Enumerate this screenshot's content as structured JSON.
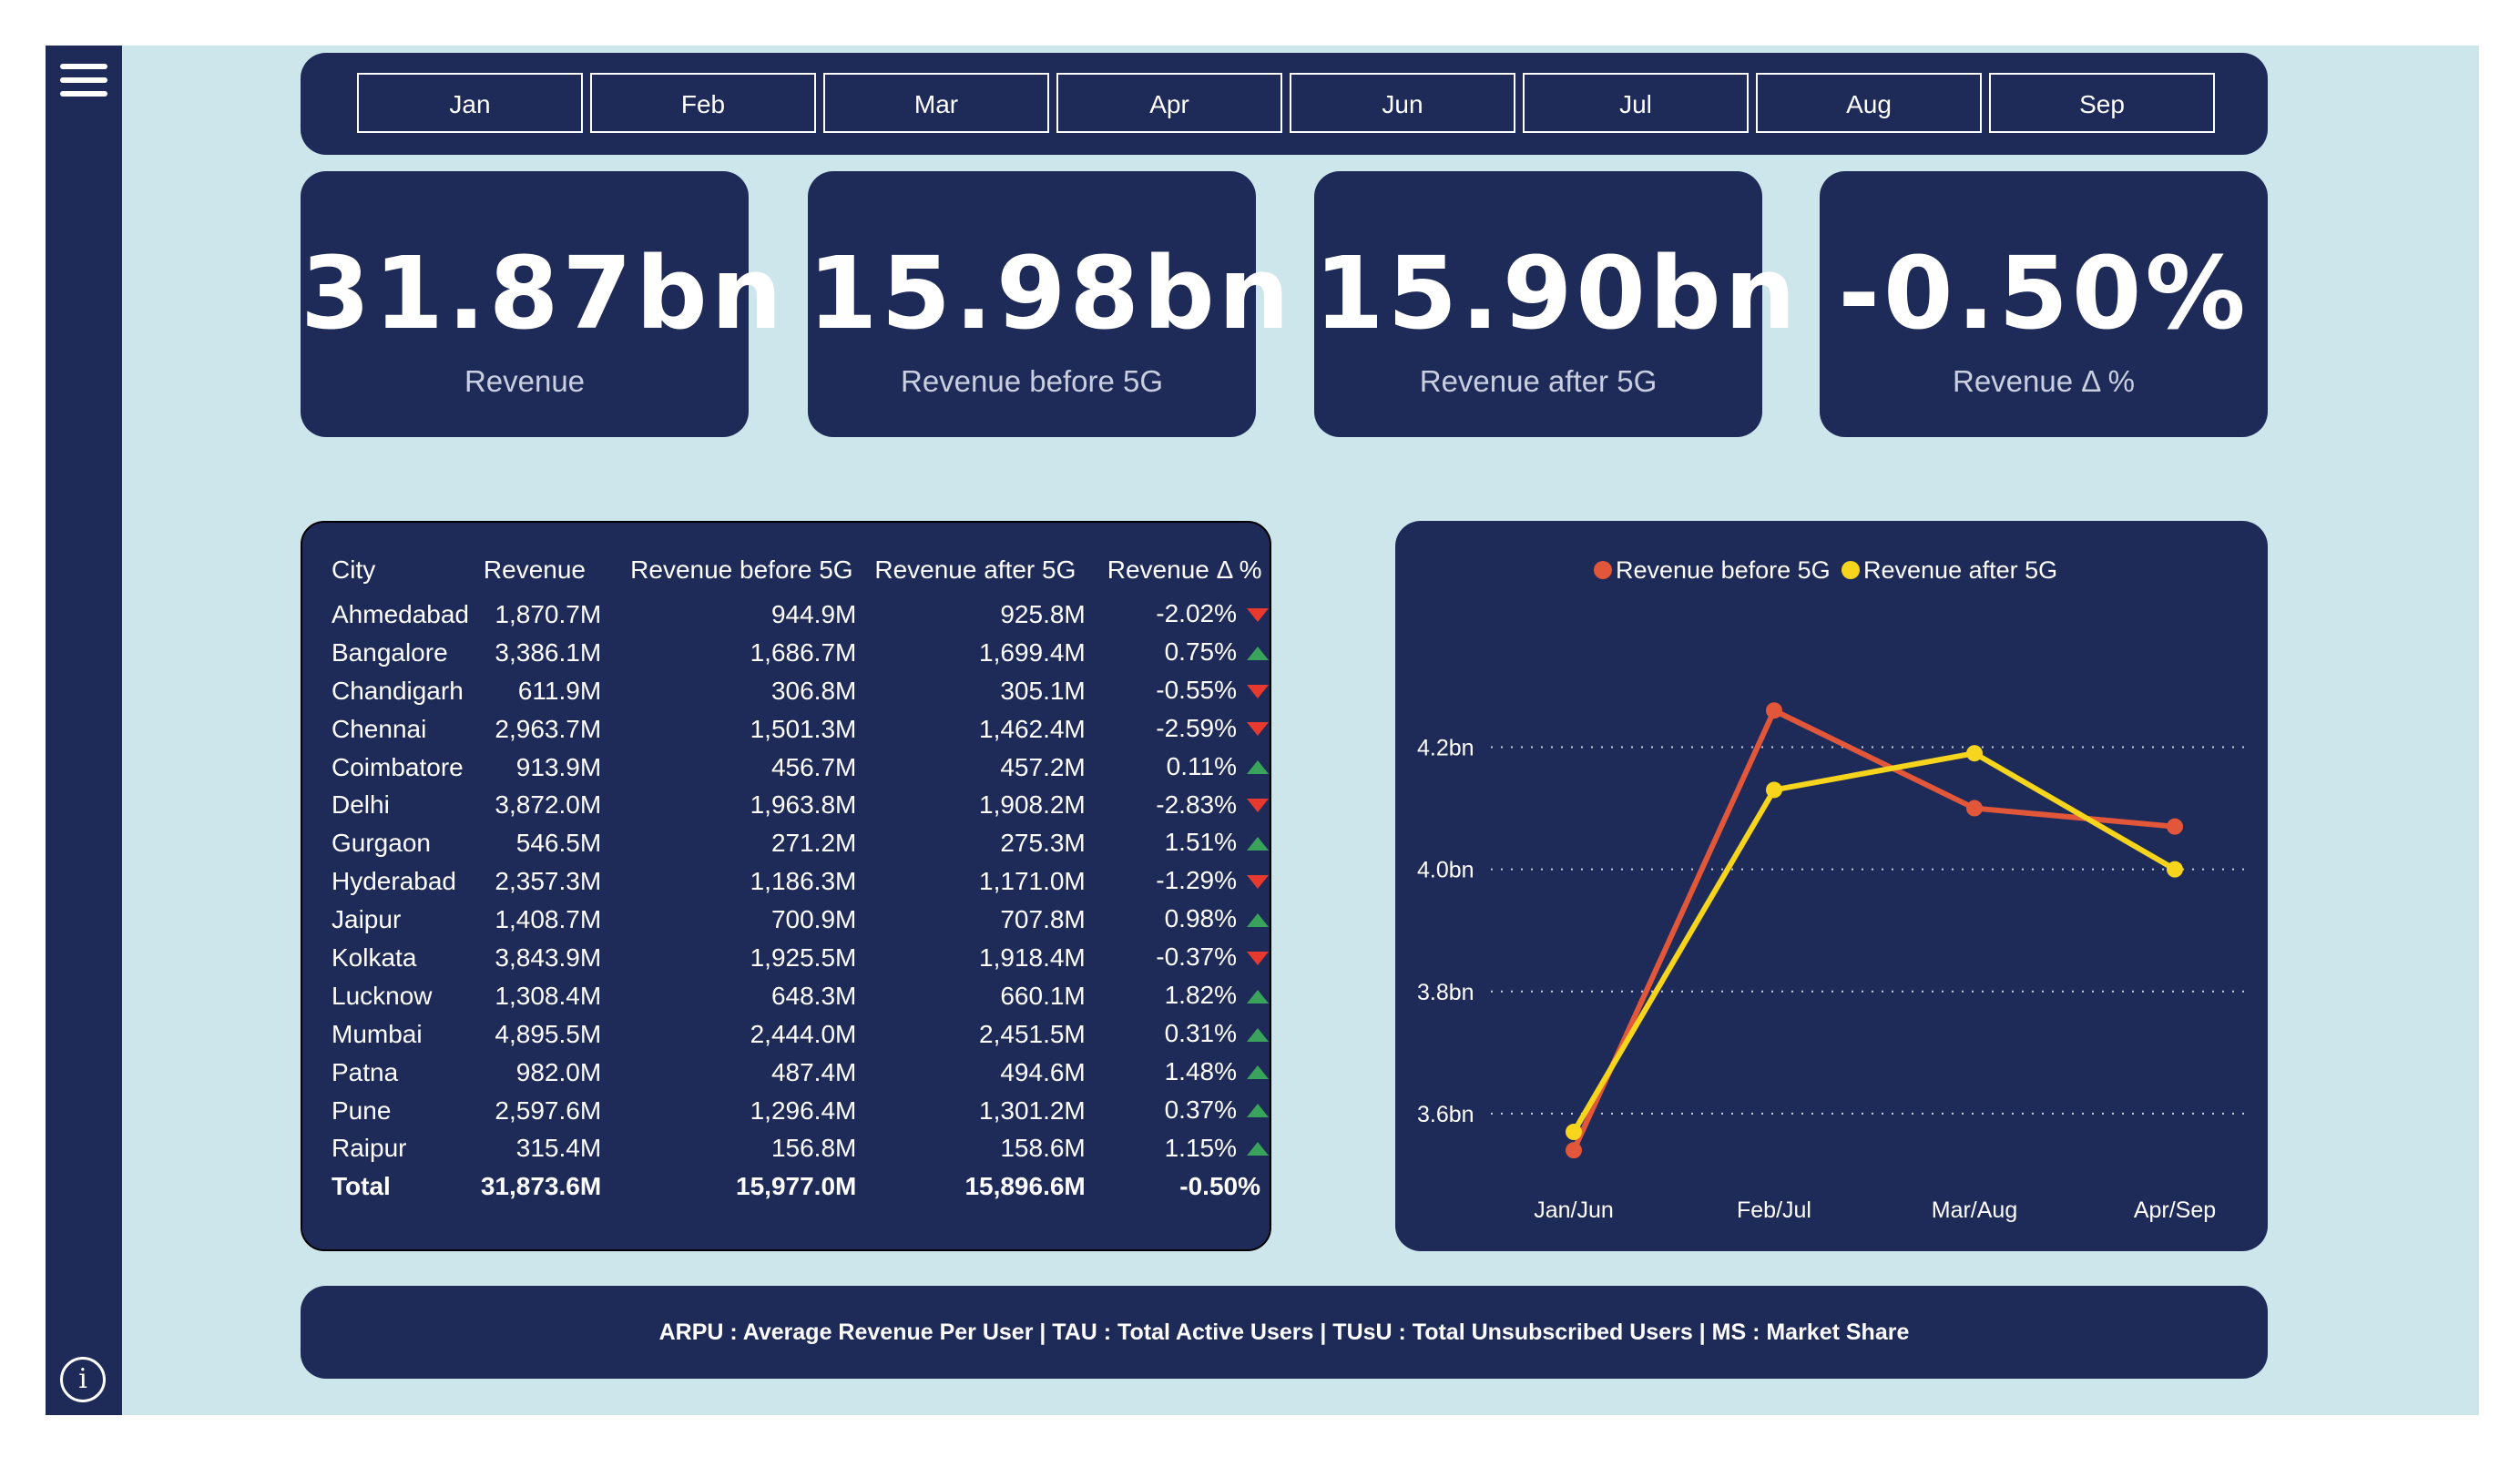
{
  "months": [
    "Jan",
    "Feb",
    "Mar",
    "Apr",
    "Jun",
    "Jul",
    "Aug",
    "Sep"
  ],
  "kpis": [
    {
      "value": "31.87bn",
      "label": "Revenue"
    },
    {
      "value": "15.98bn",
      "label": "Revenue before 5G"
    },
    {
      "value": "15.90bn",
      "label": "Revenue after 5G"
    },
    {
      "value": "-0.50%",
      "label": "Revenue Δ %"
    }
  ],
  "table": {
    "headers": [
      "City",
      "Revenue",
      "Revenue before 5G",
      "Revenue after 5G",
      "Revenue Δ %"
    ],
    "rows": [
      {
        "city": "Ahmedabad",
        "revenue": "1,870.7M",
        "before": "944.9M",
        "after": "925.8M",
        "delta": "-2.02%",
        "trend": "down"
      },
      {
        "city": "Bangalore",
        "revenue": "3,386.1M",
        "before": "1,686.7M",
        "after": "1,699.4M",
        "delta": "0.75%",
        "trend": "up"
      },
      {
        "city": "Chandigarh",
        "revenue": "611.9M",
        "before": "306.8M",
        "after": "305.1M",
        "delta": "-0.55%",
        "trend": "down"
      },
      {
        "city": "Chennai",
        "revenue": "2,963.7M",
        "before": "1,501.3M",
        "after": "1,462.4M",
        "delta": "-2.59%",
        "trend": "down"
      },
      {
        "city": "Coimbatore",
        "revenue": "913.9M",
        "before": "456.7M",
        "after": "457.2M",
        "delta": "0.11%",
        "trend": "up"
      },
      {
        "city": "Delhi",
        "revenue": "3,872.0M",
        "before": "1,963.8M",
        "after": "1,908.2M",
        "delta": "-2.83%",
        "trend": "down"
      },
      {
        "city": "Gurgaon",
        "revenue": "546.5M",
        "before": "271.2M",
        "after": "275.3M",
        "delta": "1.51%",
        "trend": "up"
      },
      {
        "city": "Hyderabad",
        "revenue": "2,357.3M",
        "before": "1,186.3M",
        "after": "1,171.0M",
        "delta": "-1.29%",
        "trend": "down"
      },
      {
        "city": "Jaipur",
        "revenue": "1,408.7M",
        "before": "700.9M",
        "after": "707.8M",
        "delta": "0.98%",
        "trend": "up"
      },
      {
        "city": "Kolkata",
        "revenue": "3,843.9M",
        "before": "1,925.5M",
        "after": "1,918.4M",
        "delta": "-0.37%",
        "trend": "down"
      },
      {
        "city": "Lucknow",
        "revenue": "1,308.4M",
        "before": "648.3M",
        "after": "660.1M",
        "delta": "1.82%",
        "trend": "up"
      },
      {
        "city": "Mumbai",
        "revenue": "4,895.5M",
        "before": "2,444.0M",
        "after": "2,451.5M",
        "delta": "0.31%",
        "trend": "up"
      },
      {
        "city": "Patna",
        "revenue": "982.0M",
        "before": "487.4M",
        "after": "494.6M",
        "delta": "1.48%",
        "trend": "up"
      },
      {
        "city": "Pune",
        "revenue": "2,597.6M",
        "before": "1,296.4M",
        "after": "1,301.2M",
        "delta": "0.37%",
        "trend": "up"
      },
      {
        "city": "Raipur",
        "revenue": "315.4M",
        "before": "156.8M",
        "after": "158.6M",
        "delta": "1.15%",
        "trend": "up"
      }
    ],
    "total": {
      "city": "Total",
      "revenue": "31,873.6M",
      "before": "15,977.0M",
      "after": "15,896.6M",
      "delta": "-0.50%"
    }
  },
  "colors": {
    "up": "#3aa35b",
    "down": "#e8392f",
    "before": "#e2573a",
    "after": "#f7d51d"
  },
  "chart_data": {
    "type": "line",
    "x": [
      "Jan/Jun",
      "Feb/Jul",
      "Mar/Aug",
      "Apr/Sep"
    ],
    "series": [
      {
        "name": "Revenue before 5G",
        "values": [
          3.54,
          4.26,
          4.1,
          4.07
        ]
      },
      {
        "name": "Revenue after 5G",
        "values": [
          3.57,
          4.13,
          4.19,
          4.0
        ]
      }
    ],
    "yticks": [
      "3.6bn",
      "3.8bn",
      "4.0bn",
      "4.2bn"
    ],
    "ytick_values": [
      3.6,
      3.8,
      4.0,
      4.2
    ],
    "ylim": [
      3.5,
      4.32
    ],
    "legend": "top",
    "grid": true
  },
  "footer": {
    "text": "ARPU : Average Revenue Per User | TAU : Total Active Users  | TUsU : Total Unsubscribed Users | MS : Market Share"
  }
}
